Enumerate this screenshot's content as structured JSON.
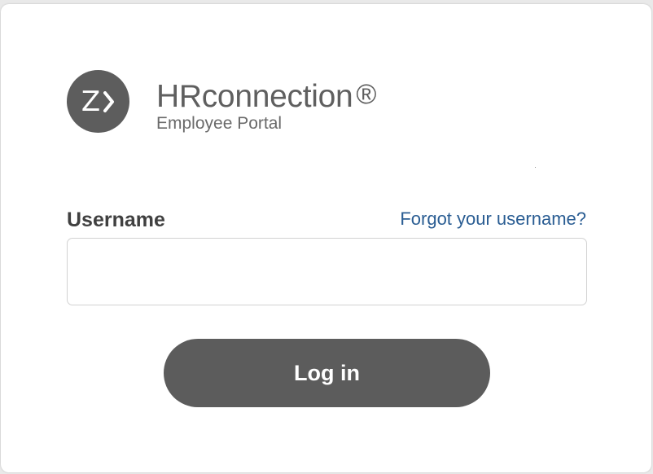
{
  "brand": {
    "logo_icon": "zeta-chevron-logo-icon",
    "logo_text": "Z",
    "title": "HRconnection",
    "registered_mark": "®",
    "subtitle": "Employee Portal"
  },
  "login_form": {
    "username_label": "Username",
    "forgot_username_link": "Forgot your username?",
    "username_value": "",
    "username_placeholder": "",
    "login_button_label": "Log in"
  },
  "colors": {
    "brand_gray": "#5c5c5c",
    "link_blue": "#2a5d93",
    "label_text": "#404040"
  }
}
